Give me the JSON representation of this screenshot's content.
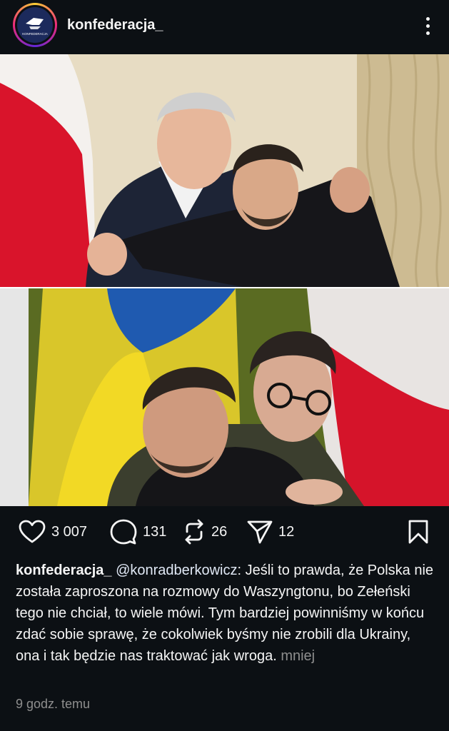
{
  "post": {
    "username": "konfederacja_",
    "avatar_text": "KONFEDERACJA",
    "more_icon": "more-vertical-icon"
  },
  "photos": [
    {
      "name": "tusk-zelensky-embrace"
    },
    {
      "name": "morawiecki-zelensky-embrace"
    }
  ],
  "actions": {
    "likes": "3 007",
    "comments": "131",
    "reposts": "26",
    "shares": "12"
  },
  "caption": {
    "username": "konfederacja_",
    "mention": "@konradberkowicz",
    "text": ": Jeśli to prawda, że Polska nie została zaproszona na rozmowy do Waszyngtonu, bo Zełeński tego nie chciał, to wiele mówi. Tym bardziej powinniśmy w końcu zdać sobie sprawę, że cokolwiek byśmy nie zrobili dla Ukrainy, ona i tak będzie nas traktować jak wroga.",
    "less_label": "mniej"
  },
  "timestamp": "9 godz. temu",
  "colors": {
    "background": "#0c1014",
    "text": "#f5f5f5",
    "muted": "#8e8e8e",
    "flag_red": "#dc143c",
    "flag_blue": "#0057b7",
    "flag_yellow": "#ffd700"
  }
}
